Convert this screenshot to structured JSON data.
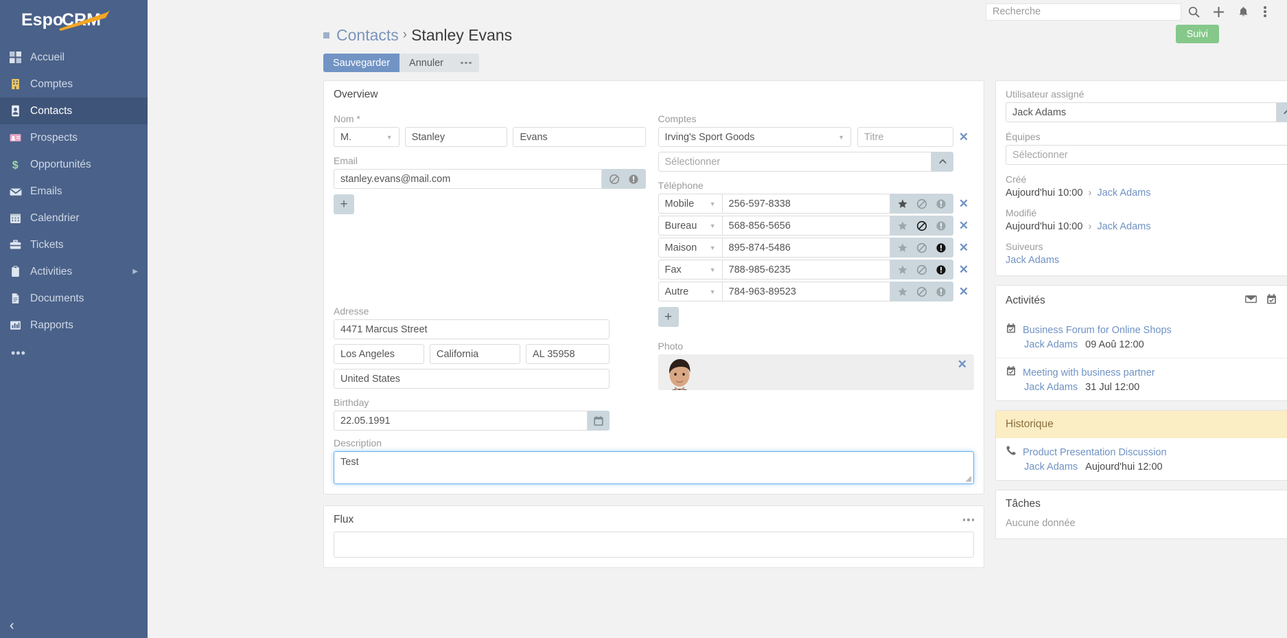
{
  "brand": {
    "name": "EspoCRM",
    "accent": "#f5a623",
    "sidebar_bg": "#4a6189"
  },
  "sidebar": {
    "items": [
      {
        "label": "Accueil",
        "icon": "dashboard-icon",
        "active": false
      },
      {
        "label": "Comptes",
        "icon": "building-icon",
        "active": false
      },
      {
        "label": "Contacts",
        "icon": "contact-card-icon",
        "active": true
      },
      {
        "label": "Prospects",
        "icon": "lead-card-icon",
        "active": false
      },
      {
        "label": "Opportunités",
        "icon": "dollar-icon",
        "active": false
      },
      {
        "label": "Emails",
        "icon": "envelope-icon",
        "active": false
      },
      {
        "label": "Calendrier",
        "icon": "calendar-icon",
        "active": false
      },
      {
        "label": "Tickets",
        "icon": "briefcase-icon",
        "active": false
      },
      {
        "label": "Activities",
        "icon": "clipboard-icon",
        "active": false,
        "has_submenu": true
      },
      {
        "label": "Documents",
        "icon": "document-icon",
        "active": false
      },
      {
        "label": "Rapports",
        "icon": "chart-icon",
        "active": false
      }
    ],
    "more_label": "•••",
    "collapse_label": "‹"
  },
  "topbar": {
    "search_placeholder": "Recherche",
    "search_value": "",
    "icons": [
      "search-icon",
      "plus-icon",
      "bell-icon",
      "kebab-menu-icon"
    ]
  },
  "header": {
    "breadcrumb_parent": "Contacts",
    "breadcrumb_sep": "›",
    "record_name": "Stanley Evans",
    "follow_button": "Suivi",
    "save_button": "Sauvegarder",
    "cancel_button": "Annuler"
  },
  "overview": {
    "title": "Overview",
    "name": {
      "label": "Nom",
      "required_mark": "*",
      "salutation": "M.",
      "first": "Stanley",
      "last": "Evans"
    },
    "email": {
      "label": "Email",
      "value": "stanley.evans@mail.com",
      "opt_out_active": false,
      "invalid_active": false
    },
    "accounts": {
      "label": "Comptes",
      "value": "Irving's Sport Goods",
      "title_placeholder": "Titre",
      "title_value": "",
      "select_placeholder": "Sélectionner"
    },
    "phone": {
      "label": "Téléphone",
      "rows": [
        {
          "type": "Mobile",
          "number": "256-597-8338",
          "primary": true,
          "opt_out": false,
          "invalid": false
        },
        {
          "type": "Bureau",
          "number": "568-856-5656",
          "primary": false,
          "opt_out": true,
          "invalid": false
        },
        {
          "type": "Maison",
          "number": "895-874-5486",
          "primary": false,
          "opt_out": false,
          "invalid": true
        },
        {
          "type": "Fax",
          "number": "788-985-6235",
          "primary": false,
          "opt_out": false,
          "invalid": true
        },
        {
          "type": "Autre",
          "number": "784-963-89523",
          "primary": false,
          "opt_out": false,
          "invalid": false
        }
      ]
    },
    "address": {
      "label": "Adresse",
      "street": "4471 Marcus Street",
      "city": "Los Angeles",
      "state": "California",
      "postal": "AL 35958",
      "country": "United States"
    },
    "photo": {
      "label": "Photo"
    },
    "birthday": {
      "label": "Birthday",
      "value": "22.05.1991"
    },
    "description": {
      "label": "Description",
      "value": "Test"
    }
  },
  "flux": {
    "title": "Flux",
    "post_placeholder": ""
  },
  "side": {
    "assigned_user": {
      "label": "Utilisateur assigné",
      "value": "Jack Adams"
    },
    "teams": {
      "label": "Équipes",
      "placeholder": "Sélectionner"
    },
    "created": {
      "label": "Créé",
      "time": "Aujourd'hui 10:00",
      "sep": "›",
      "user": "Jack Adams"
    },
    "modified": {
      "label": "Modifié",
      "time": "Aujourd'hui 10:00",
      "sep": "›",
      "user": "Jack Adams"
    },
    "followers": {
      "label": "Suiveurs",
      "value": "Jack Adams"
    }
  },
  "activities": {
    "title": "Activités",
    "items": [
      {
        "icon": "meeting-icon",
        "name": "Business Forum for Online Shops",
        "user": "Jack Adams",
        "date": "09 Aoû 12:00"
      },
      {
        "icon": "meeting-icon",
        "name": "Meeting with business partner",
        "user": "Jack Adams",
        "date": "31 Jul 12:00"
      }
    ]
  },
  "history": {
    "title": "Historique",
    "items": [
      {
        "icon": "phone-icon",
        "name": "Product Presentation Discussion",
        "user": "Jack Adams",
        "date": "Aujourd'hui 12:00"
      }
    ]
  },
  "tasks": {
    "title": "Tâches",
    "empty": "Aucune donnée"
  }
}
